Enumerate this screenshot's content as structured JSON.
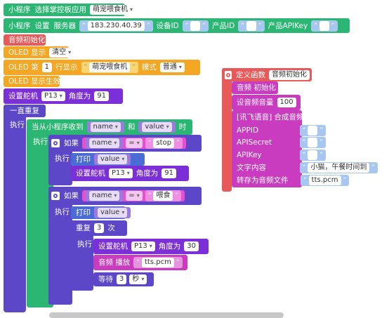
{
  "colors": {
    "green": "#2bb673",
    "red": "#e85a5a",
    "orange": "#f5a623",
    "purple": "#7b2fd6",
    "indigo": "#5b47c7",
    "magenta": "#c93cc0",
    "blue": "#4a6cd4"
  },
  "row1": {
    "prefix": "小程序",
    "label": "选择掌控板应用",
    "app": "萌宠喂食机"
  },
  "row2": {
    "prefix": "小程序",
    "label": "设置",
    "server_label": "服务器",
    "server": "183.230.40.39",
    "device_label": "设备ID",
    "product_label": "产品ID",
    "apikey_label": "产品APIKey"
  },
  "audio_init": "音频初始化",
  "oled_show": {
    "label": "OLED 显示",
    "value": "清空"
  },
  "oled_line": {
    "label": "OLED 第",
    "line": "1",
    "row_label": "行显示",
    "text": "萌宠喂食机",
    "mode_label": "模式",
    "mode": "普通"
  },
  "oled_effect": "OLED 显示生效",
  "servo1": {
    "label": "设置舵机",
    "pin": "P13",
    "angle_label": "角度为",
    "angle": "91"
  },
  "forever": "一直重复",
  "exec": "执行",
  "receive": {
    "label": "当从小程序收到",
    "name": "name",
    "and": "和",
    "value": "value",
    "when": "时"
  },
  "if1": {
    "label": "如果",
    "var": "name",
    "op": "=",
    "val": "stop"
  },
  "print1": {
    "label": "打印",
    "var": "value"
  },
  "servo2": {
    "label": "设置舵机",
    "pin": "P13",
    "angle_label": "角度为",
    "angle": "91"
  },
  "if2": {
    "label": "如果",
    "var": "name",
    "op": "=",
    "val": "喂食"
  },
  "print2": {
    "label": "打印",
    "var": "value"
  },
  "repeat": {
    "label": "重复",
    "count": "3",
    "unit": "次"
  },
  "servo3": {
    "label": "设置舵机",
    "pin": "P13",
    "angle_label": "角度为",
    "angle": "30"
  },
  "play": {
    "label": "音频 播放",
    "file": "tts.pcm"
  },
  "wait": {
    "label": "等待",
    "count": "3",
    "unit": "秒"
  },
  "func": {
    "label": "定义函数",
    "name": "音频初始化"
  },
  "audio": {
    "init": "音频 初始化",
    "volume_label": "设音频音量",
    "volume": "100",
    "tts_label": "[讯飞语音] 合成音频",
    "appid": "APPID",
    "apisecret": "APISecret",
    "apikey": "APIKey",
    "text_label": "文字内容",
    "text": "小猫，午餐时间到",
    "save_label": "转存为音频文件",
    "save": "tts.pcm"
  }
}
